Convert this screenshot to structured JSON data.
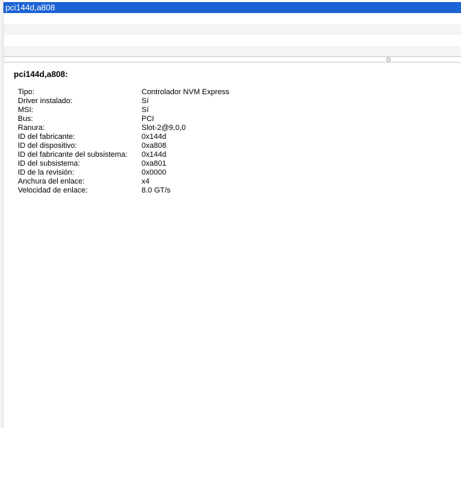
{
  "list": {
    "selected_item": "pci144d,a808"
  },
  "detail": {
    "title": "pci144d,a808:",
    "properties": [
      {
        "key": "Tipo:",
        "value": "Controlador NVM Express"
      },
      {
        "key": "Driver instalado:",
        "value": "Sí"
      },
      {
        "key": "MSI:",
        "value": "Sí"
      },
      {
        "key": "Bus:",
        "value": "PCI"
      },
      {
        "key": "Ranura:",
        "value": "Slot-2@9,0,0"
      },
      {
        "key": "ID del fabricante:",
        "value": "0x144d"
      },
      {
        "key": "ID del dispositivo:",
        "value": "0xa808"
      },
      {
        "key": "ID del fabricante del subsistema:",
        "value": "0x144d"
      },
      {
        "key": "ID del subsistema:",
        "value": "0xa801"
      },
      {
        "key": "ID de la revisión:",
        "value": "0x0000"
      },
      {
        "key": "Anchura del enlace:",
        "value": "x4"
      },
      {
        "key": "Velocidad de enlace:",
        "value": "8.0 GT/s"
      }
    ]
  },
  "colors": {
    "selection": "#1c64d6",
    "alt_row": "#f4f4f5"
  }
}
